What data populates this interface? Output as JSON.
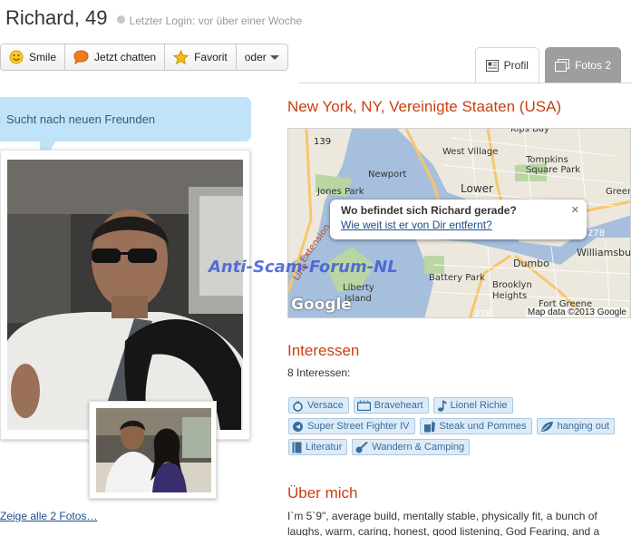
{
  "profile": {
    "name": "Richard, 49",
    "last_login": "Letzter Login: vor über einer Woche"
  },
  "actions": {
    "smile": "Smile",
    "chat": "Jetzt chatten",
    "favorite": "Favorit",
    "more": "oder"
  },
  "tabs": {
    "profile": "Profil",
    "photos": "Fotos 2"
  },
  "speech_bubble": "Sucht nach neuen Freunden",
  "show_all_photos": "Zeige alle 2 Fotos…",
  "location": "New York, NY, Vereinigte Staaten (USA)",
  "map": {
    "popup_question": "Wo befindet sich Richard gerade?",
    "popup_link": "Wie weit ist er von Dir entfernt?",
    "attribution": "Map data ©2013 Google",
    "google_logo": "Google",
    "labels": [
      "139",
      "West Village",
      "Tompkins Square Park",
      "Newport",
      "Jones Park",
      "Lower",
      "Greenp",
      "Williamsburg",
      "278",
      "Battery Park",
      "Dumbo",
      "Liberty Island",
      "Brooklyn Heights",
      "Fort Greene",
      "Extension",
      "Line",
      "278",
      "Kips Bay"
    ]
  },
  "watermark": "Anti-Scam-Forum-NL",
  "interests": {
    "title": "Interessen",
    "count": "8 Interessen:",
    "rows": [
      [
        {
          "label": "Versace",
          "icon": "ring-icon"
        },
        {
          "label": "Braveheart",
          "icon": "film-icon"
        },
        {
          "label": "Lionel Richie",
          "icon": "music-note-icon"
        }
      ],
      [
        {
          "label": "Super Street Fighter IV",
          "icon": "game-icon"
        },
        {
          "label": "Steak und Pommes",
          "icon": "drink-icon"
        },
        {
          "label": "hanging out",
          "icon": "leaf-icon"
        }
      ],
      [
        {
          "label": "Literatur",
          "icon": "book-icon"
        },
        {
          "label": "Wandern & Camping",
          "icon": "guitar-icon"
        }
      ]
    ]
  },
  "about": {
    "title": "Über mich",
    "text": "I`m 5`9\", average build, mentally stable, physically fit, a bunch of laughs, warm, caring, honest, good listening, God Fearing, and a"
  },
  "colors": {
    "accent": "#c8410f",
    "bubble": "#bfe3f9",
    "tag_bg": "#dcebf7",
    "link": "#1b4f8a",
    "watermark": "#3f5bd8"
  }
}
